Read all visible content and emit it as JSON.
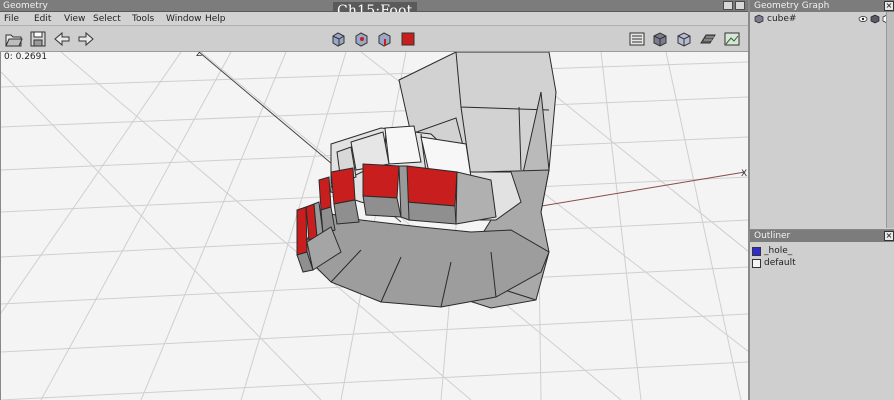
{
  "window": {
    "title": "Geometry",
    "overlay_title": "Ch15:Foot"
  },
  "menu": {
    "items": [
      "File",
      "Edit",
      "View",
      "Select",
      "Tools",
      "Window",
      "Help"
    ]
  },
  "viewport": {
    "readout": "0: 0.2691",
    "axis_label_z": "Z",
    "axis_label_x": "X"
  },
  "geometry_graph": {
    "title": "Geometry Graph",
    "item": "cube#"
  },
  "outliner": {
    "title": "Outliner",
    "close": "×",
    "rows": [
      {
        "label": "_hole_",
        "color": "#2b2bd0"
      },
      {
        "label": "default",
        "color": "#f4f4f4"
      }
    ]
  },
  "colors": {
    "accent_red": "#c81e1e",
    "title_bar": "#7c7c7c",
    "viewport_bg": "#f4f4f4"
  }
}
